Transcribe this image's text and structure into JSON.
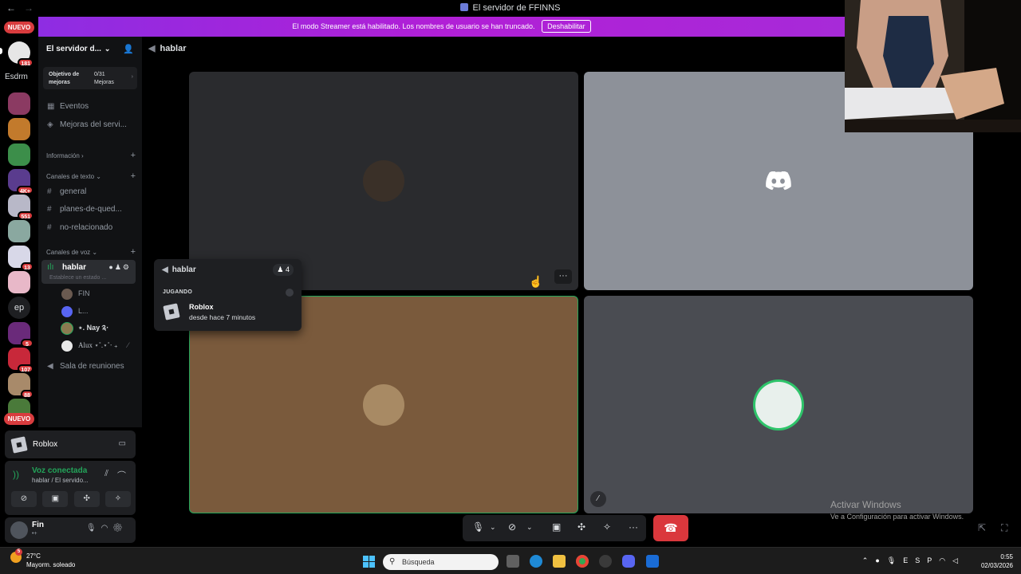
{
  "window": {
    "title": "El servidor de FFINNS"
  },
  "banner": {
    "text": "El modo Streamer está habilitado. Los nombres de usuario se han truncado.",
    "button": "Deshabilitar"
  },
  "rail": {
    "nuevo_top": "NUEVO",
    "nuevo_bottom": "NUEVO",
    "text_server": "Esdrm",
    "text_server2": "ep",
    "badges": [
      "181",
      "4K+",
      "551",
      "13",
      "5",
      "107",
      "88"
    ]
  },
  "sidebar": {
    "server_name": "El servidor d...",
    "boost": {
      "label_line1": "Objetivo de",
      "label_line2": "mejoras",
      "count": "0/31",
      "count_label": "Mejoras"
    },
    "events": "Eventos",
    "boosts": "Mejoras del servi...",
    "info_category": "Información",
    "text_category": "Canales de texto",
    "text_channels": [
      "general",
      "planes-de-qued...",
      "no-relacionado"
    ],
    "voice_category": "Canales de voz",
    "voice_channel": "hablar",
    "voice_status": "Establece un estado ...",
    "voice_users": [
      "FIN",
      "L...",
      "⋆. Nay ༉‧",
      "Alux ⋆˚.⋆˚‧ ₊"
    ],
    "meeting_room": "Sala de reuniones"
  },
  "activity_panel": {
    "game": "Roblox"
  },
  "voice_connection": {
    "status": "Voz conectada",
    "location": "hablar / El servido..."
  },
  "user_panel": {
    "name": "Fin",
    "status": "•+"
  },
  "main": {
    "channel": "hablar"
  },
  "popup": {
    "channel": "hablar",
    "count": "4",
    "label": "JUGANDO",
    "game": "Roblox",
    "time": "desde hace 7 minutos"
  },
  "watermark": {
    "line1": "Activar Windows",
    "line2": "Ve a Configuración para activar Windows."
  },
  "taskbar": {
    "weather_temp": "27°C",
    "weather_desc": "Mayorm. soleado",
    "weather_badge": "5",
    "search": "Búsqueda",
    "lang": "ESP",
    "time": "0:55",
    "date": "02/03/2026"
  }
}
